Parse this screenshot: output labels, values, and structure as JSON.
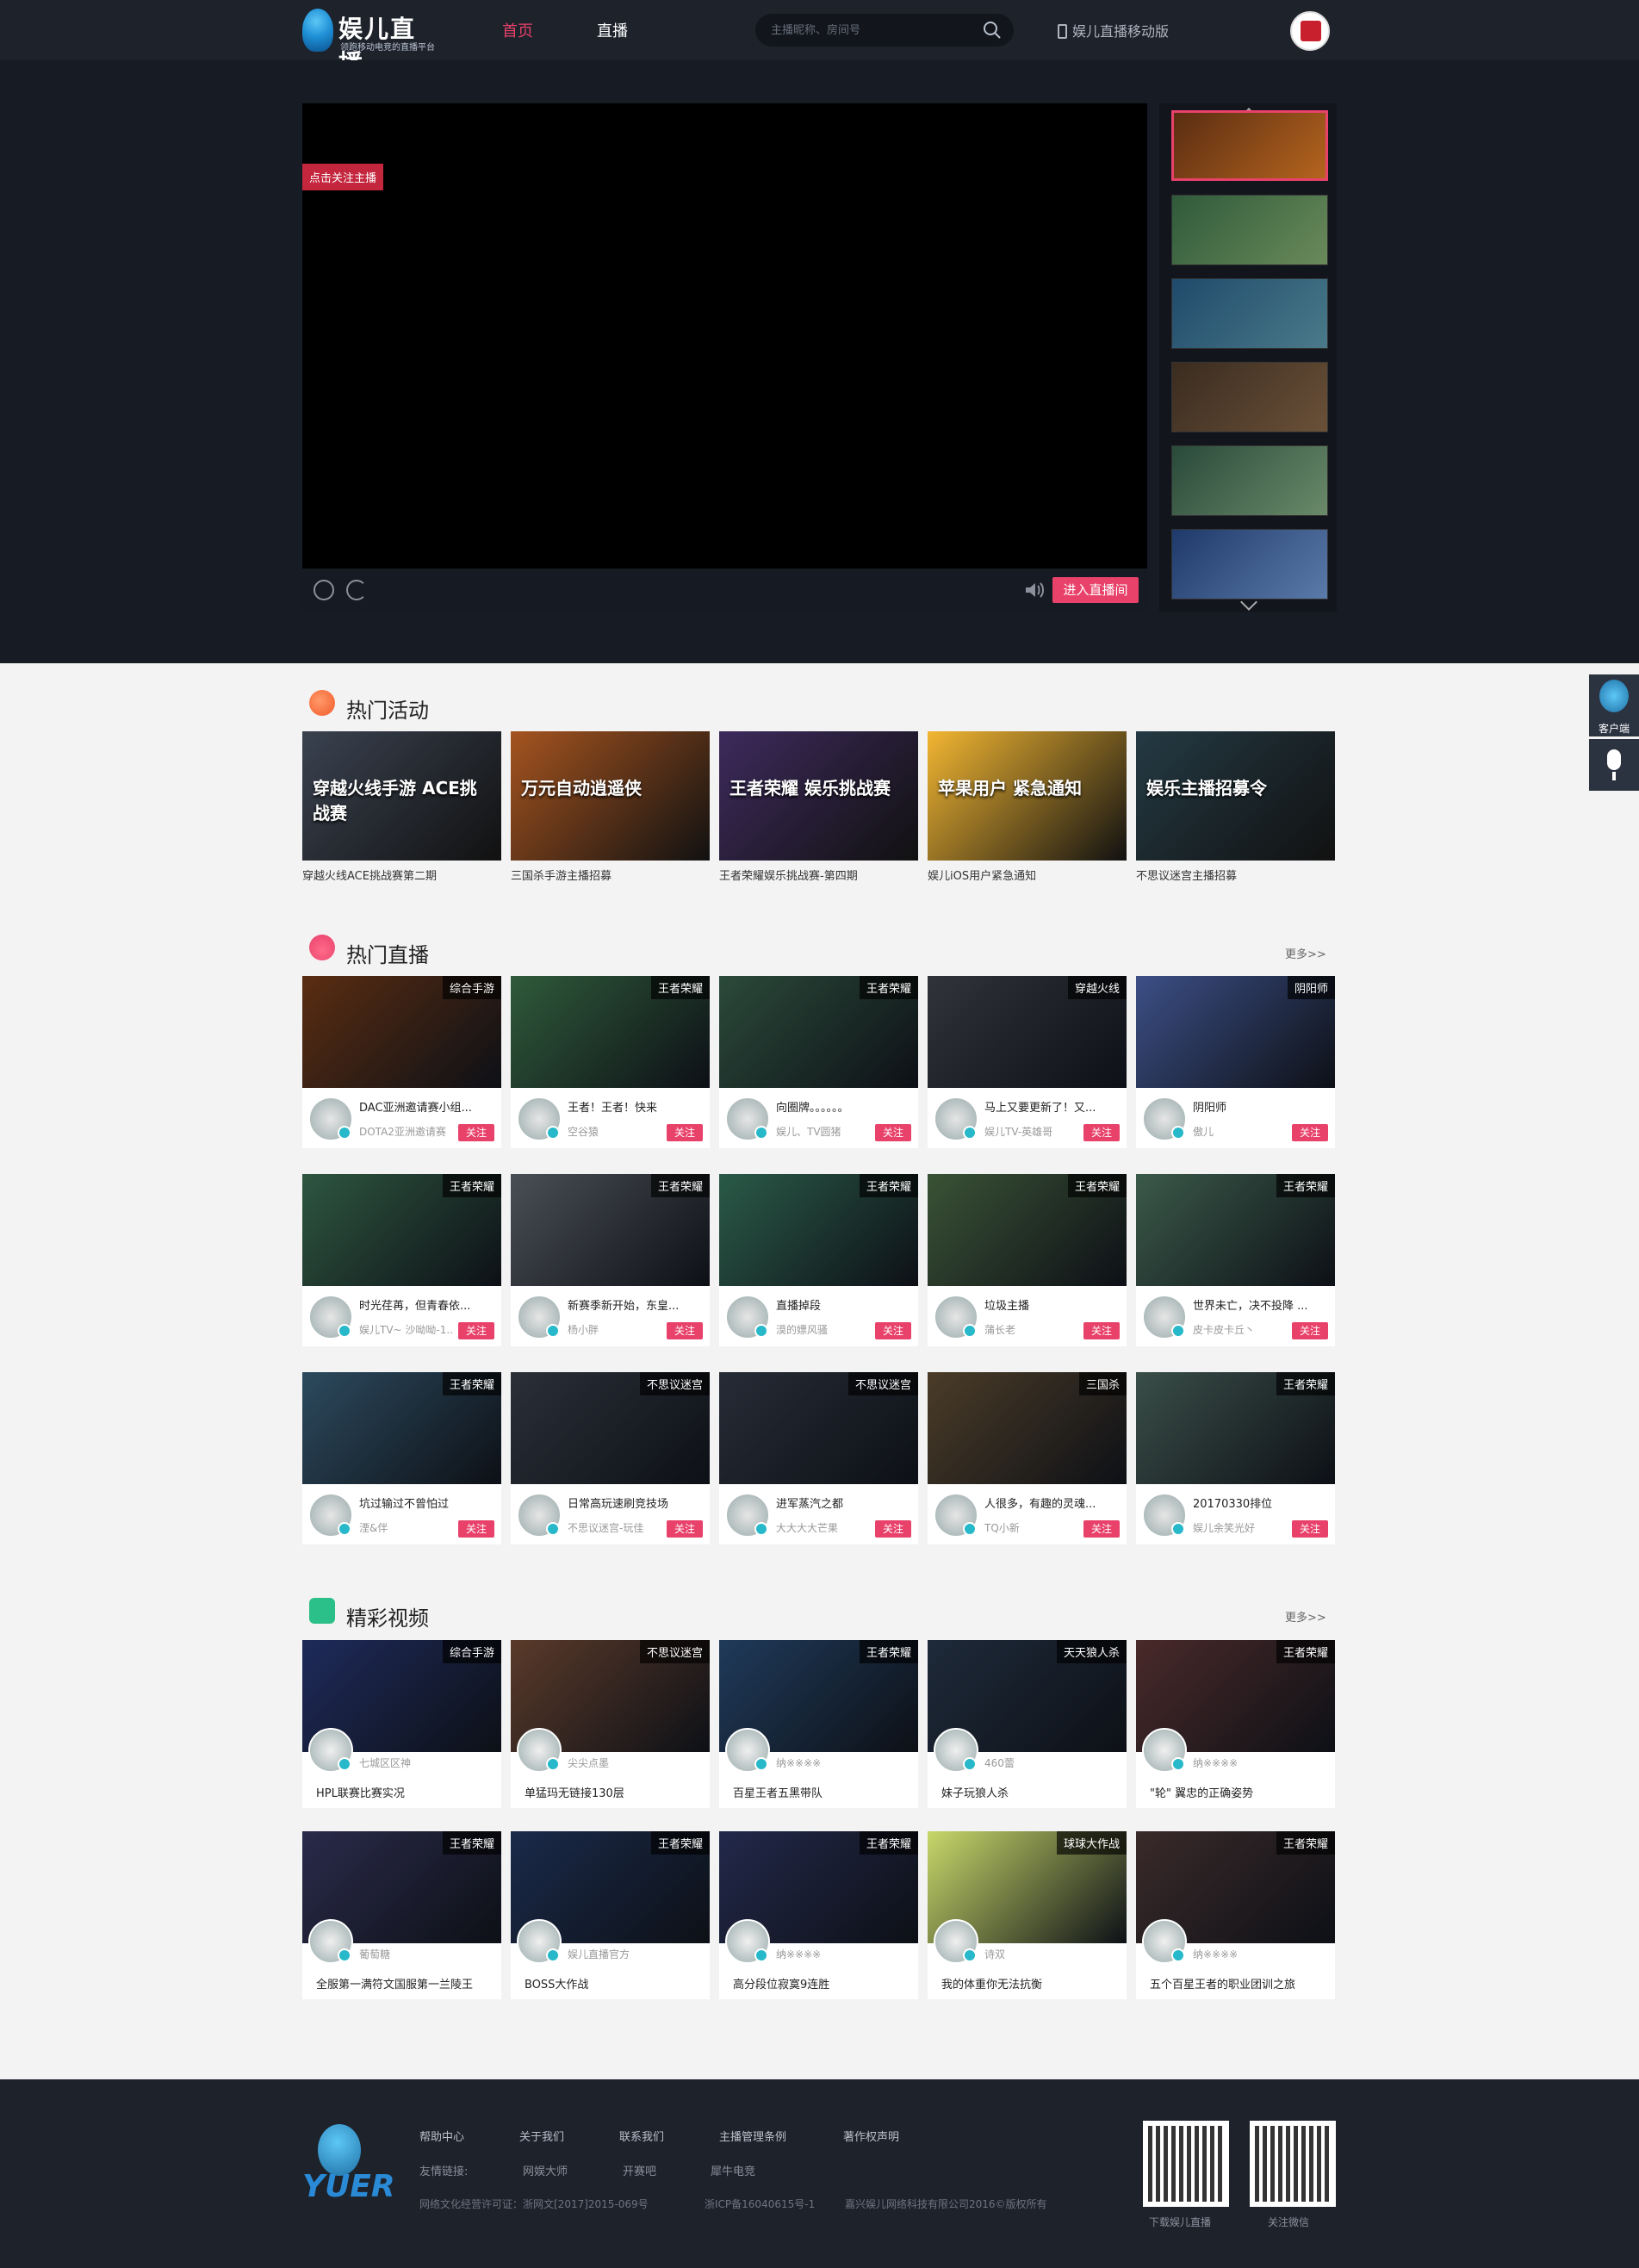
{
  "header": {
    "logo_title": "娱儿直播",
    "logo_slogan": "领跑移动电竞的直播平台",
    "nav": [
      "首页",
      "直播"
    ],
    "search_placeholder": "主播昵称、房间号",
    "mobile_link": "娱儿直播移动版"
  },
  "player": {
    "follow_tag": "点击关注主播",
    "enter_button": "进入直播间"
  },
  "side_float": {
    "client_label": "客户端"
  },
  "activities": {
    "title": "热门活动",
    "items": [
      {
        "caption": "穿越火线ACE挑战赛第二期",
        "overlay": "穿越火线手游 ACE挑战赛",
        "color": "#3a4250"
      },
      {
        "caption": "三国杀手游主播招募",
        "overlay": "万元自动逍遥侠",
        "color": "#a5541f"
      },
      {
        "caption": "王者荣耀娱乐挑战赛-第四期",
        "overlay": "王者荣耀 娱乐挑战赛",
        "color": "#3d2a5c"
      },
      {
        "caption": "娱儿iOS用户紧急通知",
        "overlay": "苹果用户 紧急通知",
        "color": "#f2b632"
      },
      {
        "caption": "不思议迷宫主播招募",
        "overlay": "娱乐主播招募令",
        "color": "#243a44"
      }
    ]
  },
  "live": {
    "title": "热门直播",
    "more": "更多>>",
    "follow_label": "关注",
    "rows": [
      [
        {
          "tag": "综合手游",
          "title": "DAC亚洲邀请赛小组...",
          "name": "DOTA2亚洲邀请赛",
          "color": "#5a2d12"
        },
        {
          "tag": "王者荣耀",
          "title": "王者！王者！快来",
          "name": "空谷猿",
          "color": "#2f5a3a"
        },
        {
          "tag": "王者荣耀",
          "title": "向圈牌。。。。。。",
          "name": "娱儿、TV圆猪",
          "color": "#2b4a3a"
        },
        {
          "tag": "穿越火线",
          "title": "马上又要更新了！又...",
          "name": "娱儿TV-英雄哥",
          "color": "#30333a"
        },
        {
          "tag": "阴阳师",
          "title": "阴阳师",
          "name": "傲儿",
          "color": "#3c4f86"
        }
      ],
      [
        {
          "tag": "王者荣耀",
          "title": "时光荏苒，但青春依...",
          "name": "娱儿TV~ 沙呦呦-1...",
          "color": "#2e5640"
        },
        {
          "tag": "王者荣耀",
          "title": "新赛季新开始，东皇...",
          "name": "杨小胖",
          "color": "#4a4f55"
        },
        {
          "tag": "王者荣耀",
          "title": "直播掉段",
          "name": "漠的嫖风骚",
          "color": "#2a5a48"
        },
        {
          "tag": "王者荣耀",
          "title": "垃圾主播",
          "name": "蒲长老",
          "color": "#3a5236"
        },
        {
          "tag": "王者荣耀",
          "title": "世界未亡，决不投降 ...",
          "name": "皮卡皮卡丘丶",
          "color": "#3b5a4a"
        }
      ],
      [
        {
          "tag": "王者荣耀",
          "title": "坑过输过不曾怕过",
          "name": "湮&伴",
          "color": "#2c4a5e"
        },
        {
          "tag": "不思议迷宫",
          "title": "日常高玩速刷竞技场",
          "name": "不思议迷宫-玩佳",
          "color": "#2a2f38"
        },
        {
          "tag": "不思议迷宫",
          "title": "进军蒸汽之都",
          "name": "大大大大芒果",
          "color": "#262c36"
        },
        {
          "tag": "三国杀",
          "title": "人很多，有趣的灵魂...",
          "name": "TQ小新",
          "color": "#4b3c28"
        },
        {
          "tag": "王者荣耀",
          "title": "20170330排位",
          "name": "娱儿余笑光好",
          "color": "#3a4e48"
        }
      ]
    ]
  },
  "videos": {
    "title": "精彩视频",
    "more": "更多>>",
    "rows": [
      [
        {
          "tag": "综合手游",
          "name": "七城区区神",
          "title": "HPL联赛比赛实况",
          "color": "#1e2a5a"
        },
        {
          "tag": "不思议迷宫",
          "name": "尖尖点墨",
          "title": "单猛玛无链接130层",
          "color": "#5a3a2a"
        },
        {
          "tag": "王者荣耀",
          "name": "纳※※※※",
          "title": "百星王者五黑带队",
          "color": "#1f3a5a"
        },
        {
          "tag": "天天狼人杀",
          "name": "460蕾",
          "title": "妹子玩狼人杀",
          "color": "#1e2a3a"
        },
        {
          "tag": "王者荣耀",
          "name": "纳※※※※",
          "title": "\"轮\" 翼忠的正确姿势",
          "color": "#4a2a2a"
        }
      ],
      [
        {
          "tag": "王者荣耀",
          "name": "葡萄糖",
          "title": "全服第一满符文国服第一兰陵王",
          "color": "#2a2a4a"
        },
        {
          "tag": "王者荣耀",
          "name": "娱儿直播官方",
          "title": "BOSS大作战",
          "color": "#1a2a4a"
        },
        {
          "tag": "王者荣耀",
          "name": "纳※※※※",
          "title": "高分段位寂寞9连胜",
          "color": "#22284a"
        },
        {
          "tag": "球球大作战",
          "name": "诗双",
          "title": "我的体重你无法抗衡",
          "color": "#c8d86a"
        },
        {
          "tag": "王者荣耀",
          "name": "纳※※※※",
          "title": "五个百星王者的职业团训之旅",
          "color": "#3a2a2a"
        }
      ]
    ]
  },
  "footer": {
    "links_row1": [
      "帮助中心",
      "关于我们",
      "联系我们",
      "主播管理条例",
      "著作权声明"
    ],
    "friends_label": "友情链接:",
    "friends": [
      "网娱大师",
      "开赛吧",
      "犀牛电竞"
    ],
    "license": "网络文化经营许可证：浙网文[2017]2015-069号",
    "icp": "浙ICP备16040615号-1",
    "copyright": "嘉兴娱儿网络科技有限公司2016©版权所有",
    "qr1_label": "下载娱儿直播",
    "qr2_label": "关注微信",
    "logo_text": "YUER"
  }
}
